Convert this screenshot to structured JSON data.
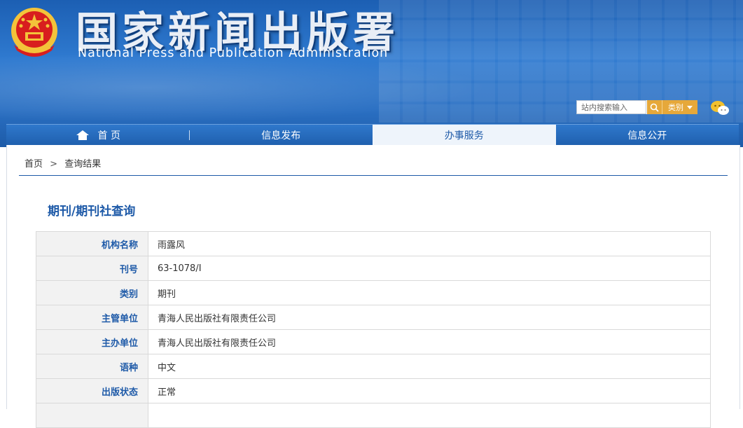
{
  "header": {
    "title_cn": "国家新闻出版署",
    "title_en": "National Press and Publication Administration",
    "search_placeholder": "站内搜索输入",
    "search_type_label": "类别"
  },
  "nav": {
    "items": [
      {
        "label": "首 页"
      },
      {
        "label": "信息发布"
      },
      {
        "label": "办事服务"
      },
      {
        "label": "信息公开"
      }
    ]
  },
  "breadcrumb": {
    "home": "首页",
    "separator": ">",
    "current": "查询结果"
  },
  "page": {
    "title": "期刊/期刊社查询"
  },
  "info": {
    "rows": [
      {
        "label": "机构名称",
        "value": "雨露风"
      },
      {
        "label": "刊号",
        "value": "63-1078/I"
      },
      {
        "label": "类别",
        "value": "期刊"
      },
      {
        "label": "主管单位",
        "value": "青海人民出版社有限责任公司"
      },
      {
        "label": "主办单位",
        "value": "青海人民出版社有限责任公司"
      },
      {
        "label": "语种",
        "value": "中文"
      },
      {
        "label": "出版状态",
        "value": "正常"
      },
      {
        "label": "",
        "value": ""
      }
    ]
  },
  "colors": {
    "brand_blue": "#1e5aa8",
    "accent_orange": "#e6a83a",
    "emblem_red": "#d81e1e",
    "emblem_gold": "#f3c33a"
  }
}
